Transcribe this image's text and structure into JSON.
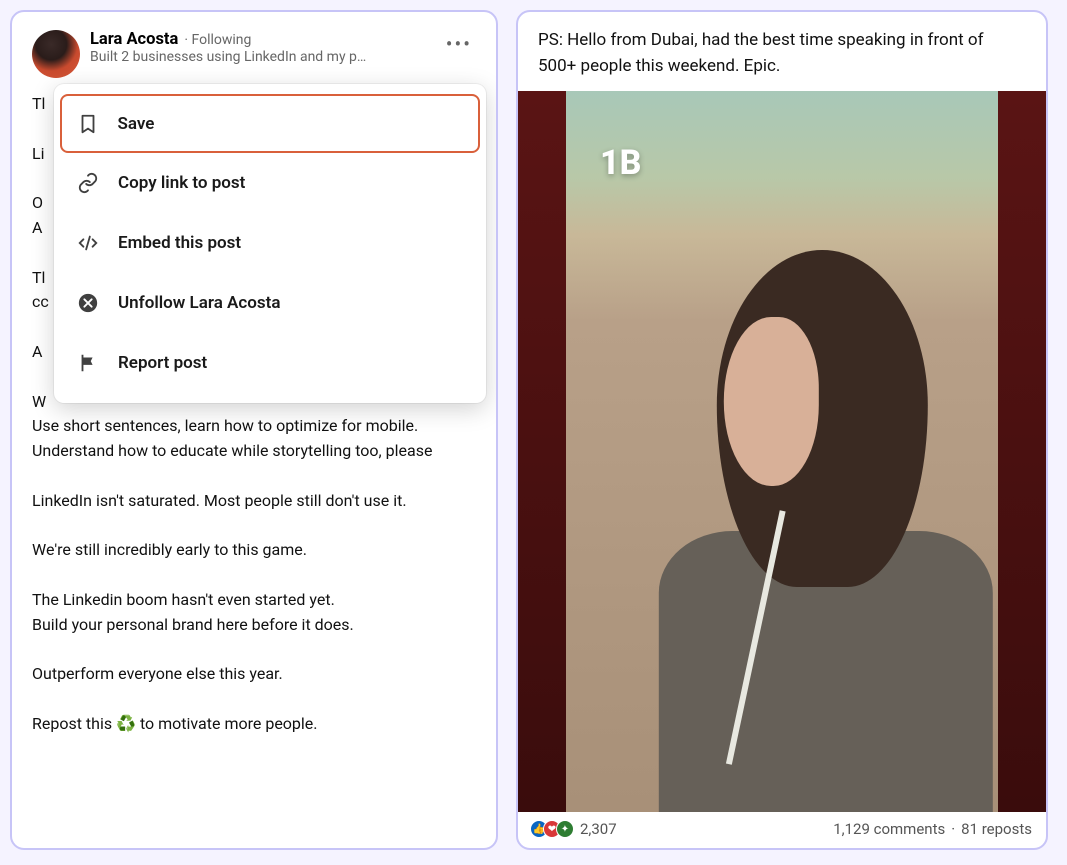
{
  "left": {
    "author": {
      "name": "Lara Acosta",
      "meta": "· Following",
      "subtitle": "Built 2 businesses using LinkedIn and my p…"
    },
    "post_text": "Tl\n\nLi\n\nO\nA\n\nTl\ncc\n\nA\n\nW\nUse short sentences, learn how to optimize for mobile.\nUnderstand how to educate while storytelling too, please\n\nLinkedIn isn't saturated. Most people still don't use it.\n\nWe're still incredibly early to this game.\n\nThe Linkedin boom hasn't even started yet.\nBuild your personal brand here before it does.\n\nOutperform everyone else this year.\n\nRepost this ♻️ to motivate more people."
  },
  "dropdown": {
    "save": "Save",
    "copy": "Copy link to post",
    "embed": "Embed this post",
    "unfollow": "Unfollow Lara Acosta",
    "report": "Report post"
  },
  "right": {
    "caption": "PS: Hello from Dubai, had the best time speaking in front of 500+ people this weekend. Epic.",
    "overlay": "1B",
    "reactions_count": "2,307",
    "comments": "1,129 comments",
    "dot": "·",
    "reposts": "81 reposts"
  }
}
